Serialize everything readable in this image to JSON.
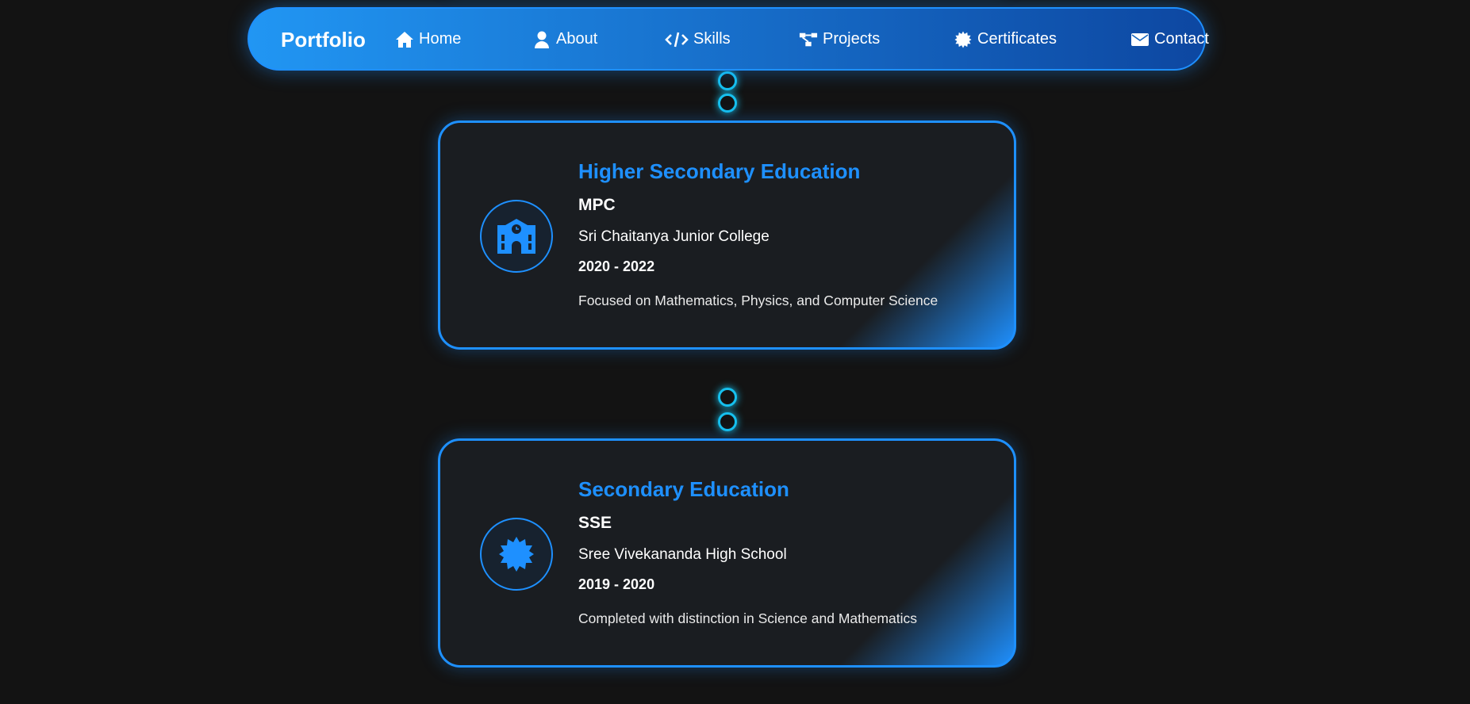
{
  "nav": {
    "brand": "Portfolio",
    "items": [
      {
        "label": "Home",
        "icon": "home-icon"
      },
      {
        "label": "About",
        "icon": "user-icon"
      },
      {
        "label": "Skills",
        "icon": "code-icon"
      },
      {
        "label": "Projects",
        "icon": "diagram-icon"
      },
      {
        "label": "Certificates",
        "icon": "certificate-icon"
      },
      {
        "label": "Contact",
        "icon": "envelope-icon"
      }
    ]
  },
  "education": [
    {
      "title": "Higher Secondary Education",
      "degree": "MPC",
      "school": "Sri Chaitanya Junior College",
      "years": "2020 - 2022",
      "description": "Focused on Mathematics, Physics, and Computer Science",
      "icon": "school-icon"
    },
    {
      "title": "Secondary Education",
      "degree": "SSE",
      "school": "Sree Vivekananda High School",
      "years": "2019 - 2020",
      "description": "Completed with distinction in Science and Mathematics",
      "icon": "certificate-icon"
    }
  ],
  "colors": {
    "accent": "#1e90ff",
    "connector": "#16c0ee",
    "background": "#131313"
  }
}
